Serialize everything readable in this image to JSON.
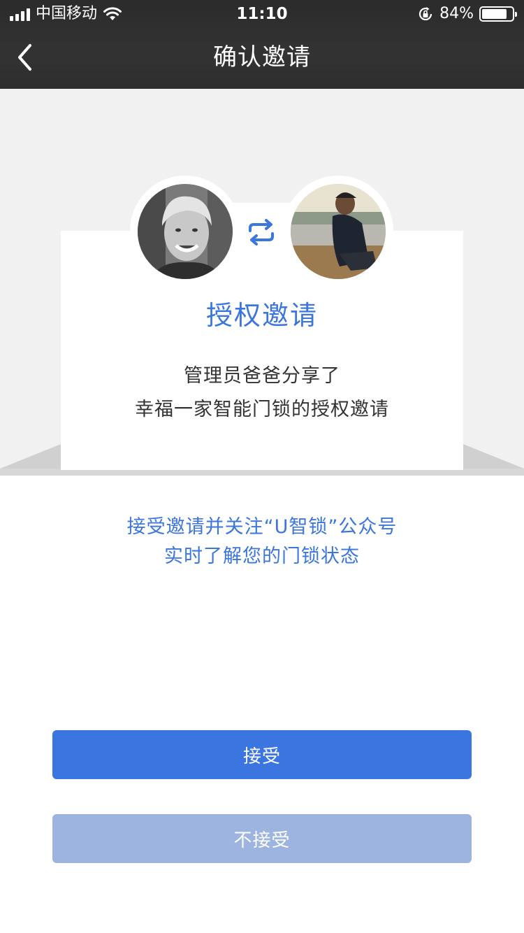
{
  "status_bar": {
    "carrier": "中国移动",
    "time": "11:10",
    "battery_percent": "84%",
    "battery_level": 0.84,
    "icons": [
      "signal-icon",
      "wifi-icon",
      "rotation-lock-icon",
      "battery-icon"
    ]
  },
  "nav": {
    "title": "确认邀请",
    "back_icon": "chevron-left-icon"
  },
  "invite_card": {
    "title": "授权邀请",
    "line1": "管理员爸爸分享了",
    "line2": "幸福一家智能门锁的授权邀请",
    "swap_icon": "swap-arrows-icon"
  },
  "notice": {
    "line1": "接受邀请并关注“U智锁”公众号",
    "line2": "实时了解您的门锁状态"
  },
  "actions": {
    "accept_label": "接受",
    "decline_label": "不接受"
  },
  "colors": {
    "accent": "#3b76e0",
    "accent_disabled": "#9db4e0",
    "header_bg": "#2e2e2e",
    "page_bg": "#f1f1f1"
  }
}
